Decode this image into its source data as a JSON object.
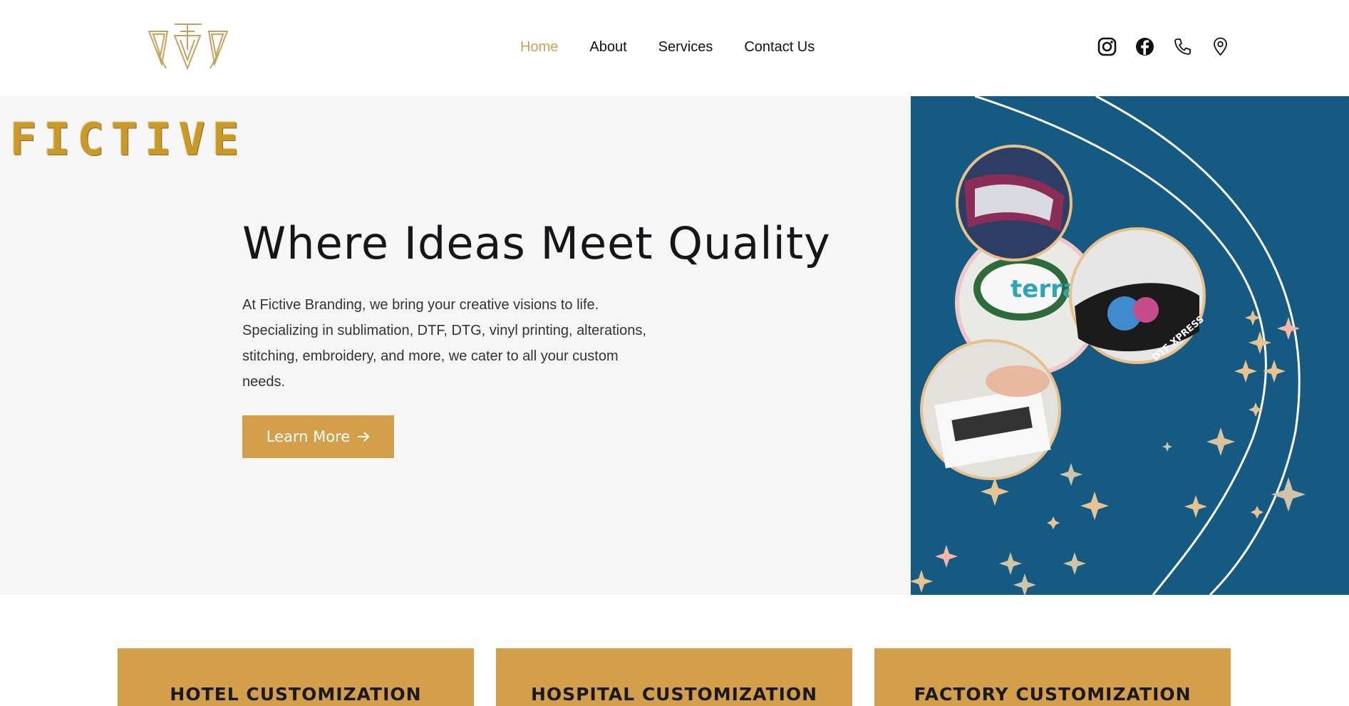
{
  "brand": {
    "logo_icon": "fictive-monogram-logo",
    "wordmark": "FICTIVE"
  },
  "nav": {
    "items": [
      {
        "label": "Home",
        "active": true
      },
      {
        "label": "About",
        "active": false
      },
      {
        "label": "Services",
        "active": false
      },
      {
        "label": "Contact Us",
        "active": false
      }
    ]
  },
  "social": {
    "icons": [
      "instagram-icon",
      "facebook-icon",
      "phone-icon",
      "location-pin-icon"
    ]
  },
  "hero": {
    "title": "Where Ideas Meet Quality",
    "text_lines": [
      "At Fictive Branding, we bring your creative visions to life.",
      "Specializing in sublimation, DTF, DTG, vinyl printing, alterations,",
      "stitching, embroidery, and more, we cater to all your custom",
      "needs."
    ],
    "button_label": "Learn More",
    "button_icon": "arrow-right-icon",
    "image_labels": [
      "terra",
      "DTF XPRESS"
    ]
  },
  "cards": [
    {
      "title": "HOTEL CUSTOMIZATION"
    },
    {
      "title": "HOSPITAL CUSTOMIZATION"
    },
    {
      "title": "FACTORY CUSTOMIZATION"
    }
  ],
  "colors": {
    "accent": "#d39f4b",
    "hero_bg": "#f6f6f6",
    "art_bg": "#155a83",
    "text_dark": "#16161a"
  }
}
